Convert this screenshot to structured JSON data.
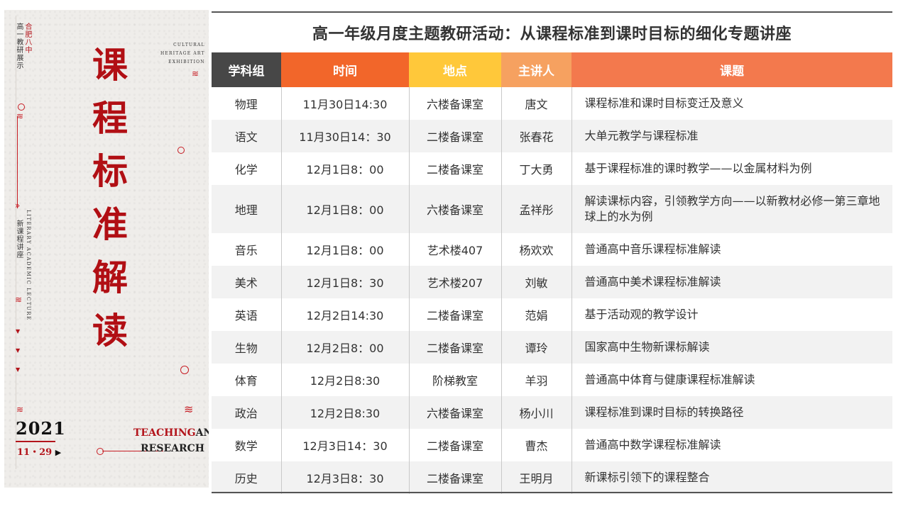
{
  "poster": {
    "vertical_cn_1": "合肥八中",
    "vertical_cn_2": "高一教研展示",
    "english_top": [
      "CULTURAL",
      "HERITAGE ART",
      "EXHIBITION"
    ],
    "title_chars": [
      "课",
      "程",
      "标",
      "准",
      "解",
      "读"
    ],
    "vertical_en": "LITERARY ACADEMIC LECTURE",
    "vertical_cn_lecture": "新课程讲座",
    "year": "2021",
    "date": "11・29",
    "teaching_red": "TEACHING",
    "teaching_and": "AND",
    "research": "RESEARCH",
    "accent_color": "#b10f14"
  },
  "page": {
    "title": "高一年级月度主题教研活动：从课程标准到课时目标的细化专题讲座"
  },
  "table": {
    "headers": [
      "学科组",
      "时间",
      "地点",
      "主讲人",
      "课题"
    ],
    "header_colors": [
      "#474747",
      "#f2662a",
      "#ffc83a",
      "#f6a160",
      "#f3794d"
    ],
    "rows": [
      {
        "subject": "物理",
        "time": "11月30日14:30",
        "place": "六楼备课室",
        "speaker": "唐文",
        "topic": "课程标准和课时目标变迁及意义"
      },
      {
        "subject": "语文",
        "time": "11月30日14：30",
        "place": "二楼备课室",
        "speaker": "张春花",
        "topic": "大单元教学与课程标准"
      },
      {
        "subject": "化学",
        "time": "12月1日8：00",
        "place": "二楼备课室",
        "speaker": "丁大勇",
        "topic": "基于课程标准的课时教学——以金属材料为例"
      },
      {
        "subject": "地理",
        "time": "12月1日8：00",
        "place": "六楼备课室",
        "speaker": "孟祥彤",
        "topic": "解读课标内容，引领教学方向——以新教材必修一第三章地球上的水为例"
      },
      {
        "subject": "音乐",
        "time": "12月1日8：00",
        "place": "艺术楼407",
        "speaker": "杨欢欢",
        "topic": "普通高中音乐课程标准解读"
      },
      {
        "subject": "美术",
        "time": "12月1日8：30",
        "place": "艺术楼207",
        "speaker": "刘敏",
        "topic": "普通高中美术课程标准解读"
      },
      {
        "subject": "英语",
        "time": "12月2日14:30",
        "place": "二楼备课室",
        "speaker": "范娟",
        "topic": "基于活动观的教学设计"
      },
      {
        "subject": "生物",
        "time": "12月2日8：00",
        "place": "二楼备课室",
        "speaker": "谭玲",
        "topic": "国家高中生物新课标解读"
      },
      {
        "subject": "体育",
        "time": "12月2日8:30",
        "place": "阶梯教室",
        "speaker": "羊羽",
        "topic": "普通高中体育与健康课程标准解读"
      },
      {
        "subject": "政治",
        "time": "12月2日8:30",
        "place": "六楼备课室",
        "speaker": "杨小川",
        "topic": "课程标准到课时目标的转换路径"
      },
      {
        "subject": "数学",
        "time": "12月3日14：30",
        "place": "二楼备课室",
        "speaker": "曹杰",
        "topic": "普通高中数学课程标准解读"
      },
      {
        "subject": "历史",
        "time": "12月3日8：30",
        "place": "二楼备课室",
        "speaker": "王明月",
        "topic": "新课标引领下的课程整合"
      }
    ]
  }
}
